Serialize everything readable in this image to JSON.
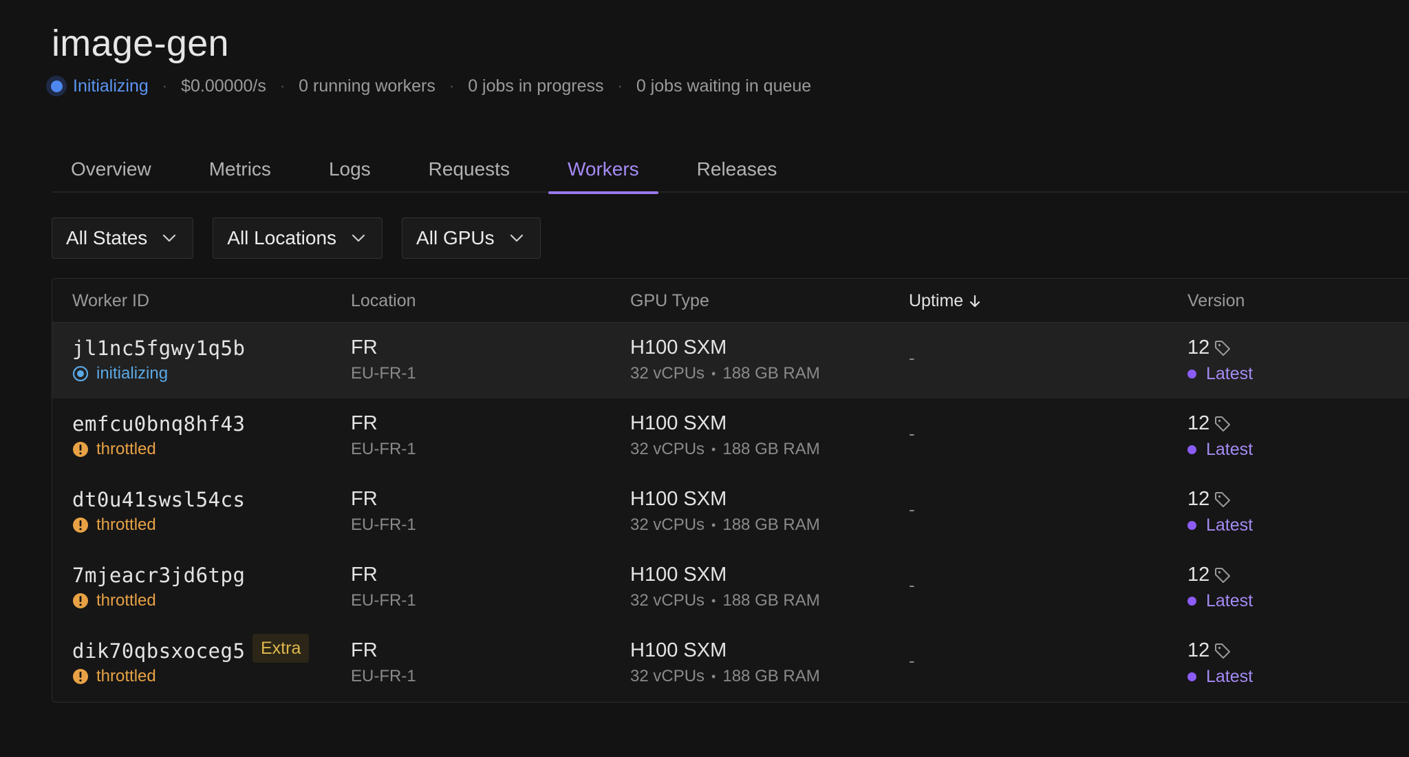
{
  "header": {
    "title": "image-gen",
    "status": "Initializing",
    "cost": "$0.00000/s",
    "running_workers": "0 running workers",
    "jobs_in_progress": "0 jobs in progress",
    "jobs_in_queue": "0 jobs waiting in queue",
    "separator": "·"
  },
  "tabs": [
    {
      "label": "Overview",
      "active": false
    },
    {
      "label": "Metrics",
      "active": false
    },
    {
      "label": "Logs",
      "active": false
    },
    {
      "label": "Requests",
      "active": false
    },
    {
      "label": "Workers",
      "active": true
    },
    {
      "label": "Releases",
      "active": false
    }
  ],
  "filters": {
    "states": "All States",
    "locations": "All Locations",
    "gpus": "All GPUs"
  },
  "table": {
    "columns": {
      "worker_id": "Worker ID",
      "location": "Location",
      "gpu_type": "GPU Type",
      "uptime": "Uptime",
      "version": "Version"
    },
    "rows": [
      {
        "id": "jl1nc5fgwy1q5b",
        "state": "initializing",
        "location": "FR",
        "region": "EU-FR-1",
        "gpu": "H100 SXM",
        "vcpus": "32 vCPUs",
        "ram": "188 GB RAM",
        "uptime": "-",
        "version": "12",
        "tag": "Latest",
        "badge": ""
      },
      {
        "id": "emfcu0bnq8hf43",
        "state": "throttled",
        "location": "FR",
        "region": "EU-FR-1",
        "gpu": "H100 SXM",
        "vcpus": "32 vCPUs",
        "ram": "188 GB RAM",
        "uptime": "-",
        "version": "12",
        "tag": "Latest",
        "badge": ""
      },
      {
        "id": "dt0u41swsl54cs",
        "state": "throttled",
        "location": "FR",
        "region": "EU-FR-1",
        "gpu": "H100 SXM",
        "vcpus": "32 vCPUs",
        "ram": "188 GB RAM",
        "uptime": "-",
        "version": "12",
        "tag": "Latest",
        "badge": ""
      },
      {
        "id": "7mjeacr3jd6tpg",
        "state": "throttled",
        "location": "FR",
        "region": "EU-FR-1",
        "gpu": "H100 SXM",
        "vcpus": "32 vCPUs",
        "ram": "188 GB RAM",
        "uptime": "-",
        "version": "12",
        "tag": "Latest",
        "badge": ""
      },
      {
        "id": "dik70qbsxoceg5",
        "state": "throttled",
        "location": "FR",
        "region": "EU-FR-1",
        "gpu": "H100 SXM",
        "vcpus": "32 vCPUs",
        "ram": "188 GB RAM",
        "uptime": "-",
        "version": "12",
        "tag": "Latest",
        "badge": "Extra"
      }
    ]
  },
  "colors": {
    "accent": "#a58bf5",
    "initializing": "#5aa9e6",
    "throttled": "#e8a245",
    "status_blue": "#4f87f0"
  },
  "icons": {
    "filter_chevron": "chevron-down-icon",
    "sort": "arrow-down-icon",
    "version_tag": "tag-icon",
    "initializing": "radio-spinner-icon",
    "throttled": "warning-circle-icon"
  }
}
